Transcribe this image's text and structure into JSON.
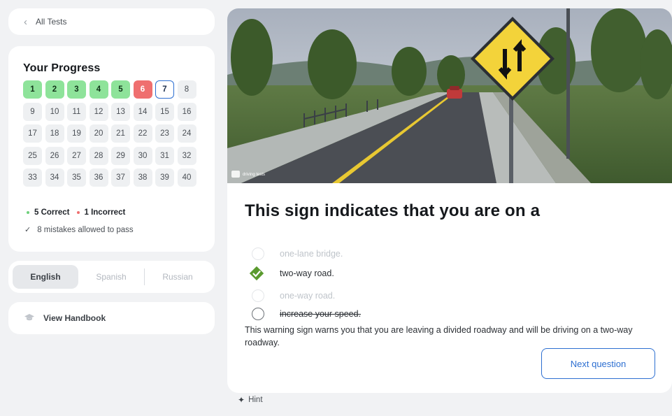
{
  "nav": {
    "back_label": "All Tests",
    "back_icon": "chevron-left-icon"
  },
  "progress": {
    "title": "Your Progress",
    "questions": [
      {
        "n": "1",
        "state": "correct"
      },
      {
        "n": "2",
        "state": "correct"
      },
      {
        "n": "3",
        "state": "correct"
      },
      {
        "n": "4",
        "state": "correct"
      },
      {
        "n": "5",
        "state": "correct"
      },
      {
        "n": "6",
        "state": "incorrect"
      },
      {
        "n": "7",
        "state": "current"
      },
      {
        "n": "8",
        "state": "pending"
      },
      {
        "n": "9",
        "state": "pending"
      },
      {
        "n": "10",
        "state": "pending"
      },
      {
        "n": "11",
        "state": "pending"
      },
      {
        "n": "12",
        "state": "pending"
      },
      {
        "n": "13",
        "state": "pending"
      },
      {
        "n": "14",
        "state": "pending"
      },
      {
        "n": "15",
        "state": "pending"
      },
      {
        "n": "16",
        "state": "pending"
      },
      {
        "n": "17",
        "state": "pending"
      },
      {
        "n": "18",
        "state": "pending"
      },
      {
        "n": "19",
        "state": "pending"
      },
      {
        "n": "20",
        "state": "pending"
      },
      {
        "n": "21",
        "state": "pending"
      },
      {
        "n": "22",
        "state": "pending"
      },
      {
        "n": "23",
        "state": "pending"
      },
      {
        "n": "24",
        "state": "pending"
      },
      {
        "n": "25",
        "state": "pending"
      },
      {
        "n": "26",
        "state": "pending"
      },
      {
        "n": "27",
        "state": "pending"
      },
      {
        "n": "28",
        "state": "pending"
      },
      {
        "n": "29",
        "state": "pending"
      },
      {
        "n": "30",
        "state": "pending"
      },
      {
        "n": "31",
        "state": "pending"
      },
      {
        "n": "32",
        "state": "pending"
      },
      {
        "n": "33",
        "state": "pending"
      },
      {
        "n": "34",
        "state": "pending"
      },
      {
        "n": "35",
        "state": "pending"
      },
      {
        "n": "36",
        "state": "pending"
      },
      {
        "n": "37",
        "state": "pending"
      },
      {
        "n": "38",
        "state": "pending"
      },
      {
        "n": "39",
        "state": "pending"
      },
      {
        "n": "40",
        "state": "pending"
      }
    ],
    "correct_label": "5 Correct",
    "incorrect_label": "1 Incorrect",
    "mistakes_label": "8 mistakes allowed to pass",
    "colors": {
      "correct": "#8ee39a",
      "incorrect": "#ef6f6f",
      "current_border": "#2d6fd1"
    }
  },
  "languages": {
    "items": [
      {
        "label": "English",
        "active": true
      },
      {
        "label": "Spanish",
        "active": false
      },
      {
        "label": "Russian",
        "active": false
      }
    ]
  },
  "handbook": {
    "label": "View Handbook",
    "icon": "graduation-cap-icon"
  },
  "question": {
    "image_watermark": "driving tests",
    "sign": "two-way-traffic-sign",
    "text": "This sign indicates that you are on a",
    "answers": [
      {
        "label": "one-lane bridge.",
        "state": "faded"
      },
      {
        "label": "two-way road.",
        "state": "selected-correct"
      },
      {
        "label": "one-way road.",
        "state": "faded"
      },
      {
        "label": "increase your speed.",
        "state": "struck"
      }
    ],
    "explanation": "This warning sign warns you that you are leaving a divided roadway and will be driving on a two-way roadway.",
    "next_label": "Next question",
    "accent": "#2d6fd1",
    "correct_accent": "#5a9a2e"
  },
  "hint": {
    "label": "Hint",
    "icon": "sparkle-icon"
  }
}
